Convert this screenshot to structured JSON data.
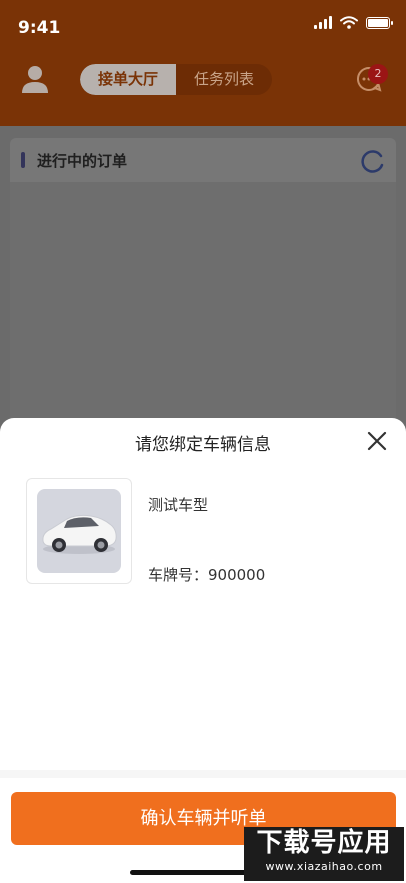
{
  "status_bar": {
    "time": "9:41"
  },
  "top_nav": {
    "tabs": [
      {
        "label": "接单大厅"
      },
      {
        "label": "任务列表"
      }
    ],
    "message_badge_count": "2"
  },
  "orders_section": {
    "title": "进行中的订单"
  },
  "bind_sheet": {
    "title": "请您绑定车辆信息",
    "vehicle_model": "测试车型",
    "plate_label": "车牌号：900000",
    "confirm_label": "确认车辆并听单"
  },
  "watermark": {
    "main": "下载号应用",
    "sub": "www.xiazaihao.com"
  },
  "colors": {
    "accent": "#f06f1e",
    "header_dimmed": "#7a3306",
    "badge": "#9b1515"
  },
  "icons": [
    "signal-icon",
    "wifi-icon",
    "battery-icon",
    "user-avatar-icon",
    "message-icon",
    "refresh-icon",
    "close-icon"
  ]
}
